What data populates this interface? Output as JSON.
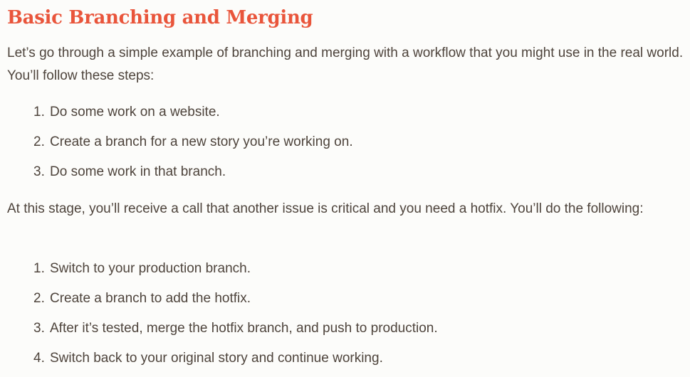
{
  "heading": "Basic Branching and Merging",
  "intro": "Let’s go through a simple example of branching and merging with a workflow that you might use in the real world. You’ll follow these steps:",
  "steps": [
    {
      "num": "1.",
      "text": "Do some work on a website."
    },
    {
      "num": "2.",
      "text": "Create a branch for a new story you’re working on."
    },
    {
      "num": "3.",
      "text": "Do some work in that branch."
    }
  ],
  "middle": "At this stage, you’ll receive a call that another issue is critical and you need a hotfix. You’ll do the following:",
  "hotfix_steps": [
    {
      "num": "1.",
      "text": "Switch to your production branch."
    },
    {
      "num": "2.",
      "text": "Create a branch to add the hotfix."
    },
    {
      "num": "3.",
      "text": "After it’s tested, merge the hotfix branch, and push to production."
    },
    {
      "num": "4.",
      "text": "Switch back to your original story and continue working."
    }
  ],
  "colors": {
    "heading": "#e9553b",
    "text": "#4e443c",
    "background": "#fcfcfa"
  }
}
